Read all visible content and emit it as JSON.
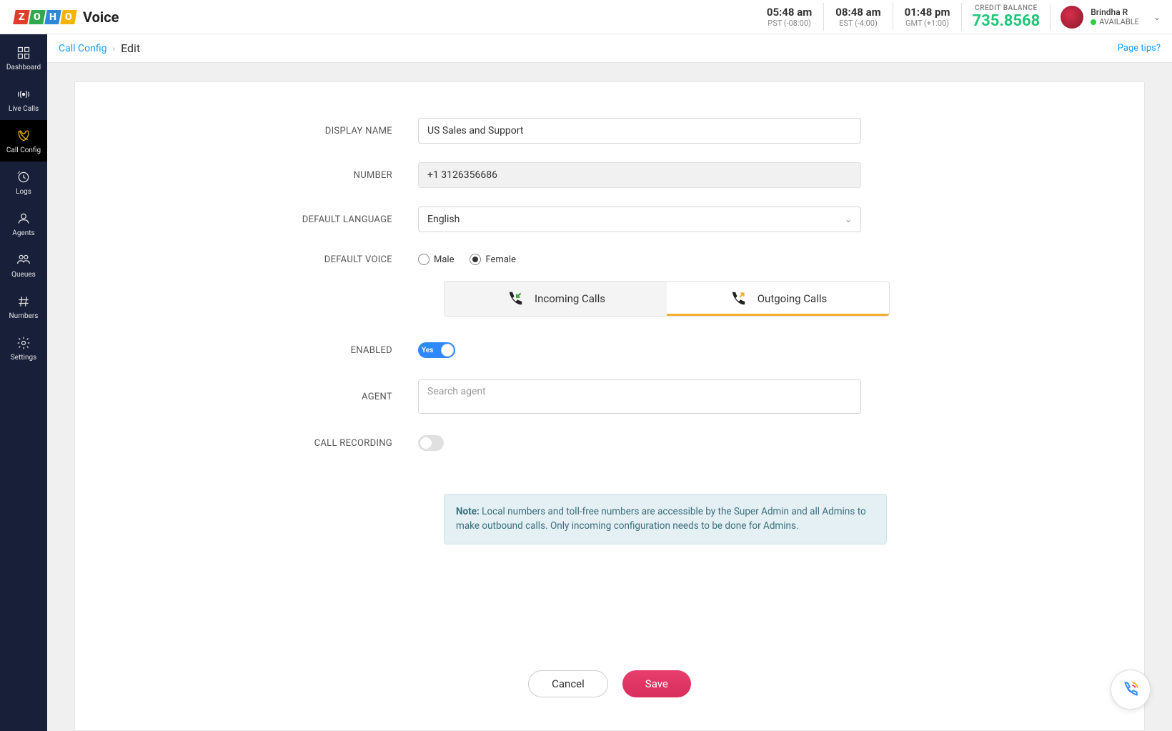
{
  "brand": {
    "product": "Voice"
  },
  "header": {
    "times": [
      {
        "time": "05:48 am",
        "zone": "PST (-08:00)"
      },
      {
        "time": "08:48 am",
        "zone": "EST (-4:00)"
      },
      {
        "time": "01:48 pm",
        "zone": "GMT (+1:00)"
      }
    ],
    "credit_label": "CREDIT BALANCE",
    "credit_amount": "735.8568",
    "user_name": "Brindha R",
    "user_status": "AVAILABLE"
  },
  "sidebar": {
    "items": [
      {
        "label": "Dashboard"
      },
      {
        "label": "Live Calls"
      },
      {
        "label": "Call Config"
      },
      {
        "label": "Logs"
      },
      {
        "label": "Agents"
      },
      {
        "label": "Queues"
      },
      {
        "label": "Numbers"
      },
      {
        "label": "Settings"
      }
    ]
  },
  "breadcrumb": {
    "link": "Call Config",
    "current": "Edit",
    "tips": "Page tips?"
  },
  "form": {
    "display_name_label": "DISPLAY NAME",
    "display_name_value": "US Sales and Support",
    "number_label": "NUMBER",
    "number_value": "+1 3126356686",
    "language_label": "DEFAULT LANGUAGE",
    "language_value": "English",
    "voice_label": "DEFAULT VOICE",
    "voice_male": "Male",
    "voice_female": "Female",
    "tab_incoming": "Incoming Calls",
    "tab_outgoing": "Outgoing Calls",
    "enabled_label": "ENABLED",
    "enabled_text": "Yes",
    "agent_label": "AGENT",
    "agent_placeholder": "Search agent",
    "recording_label": "CALL RECORDING",
    "note_label": "Note:",
    "note_text": "Local numbers and toll-free numbers are accessible by the Super Admin and all Admins to make outbound calls. Only incoming configuration needs to be done for Admins."
  },
  "footer": {
    "cancel": "Cancel",
    "save": "Save"
  }
}
